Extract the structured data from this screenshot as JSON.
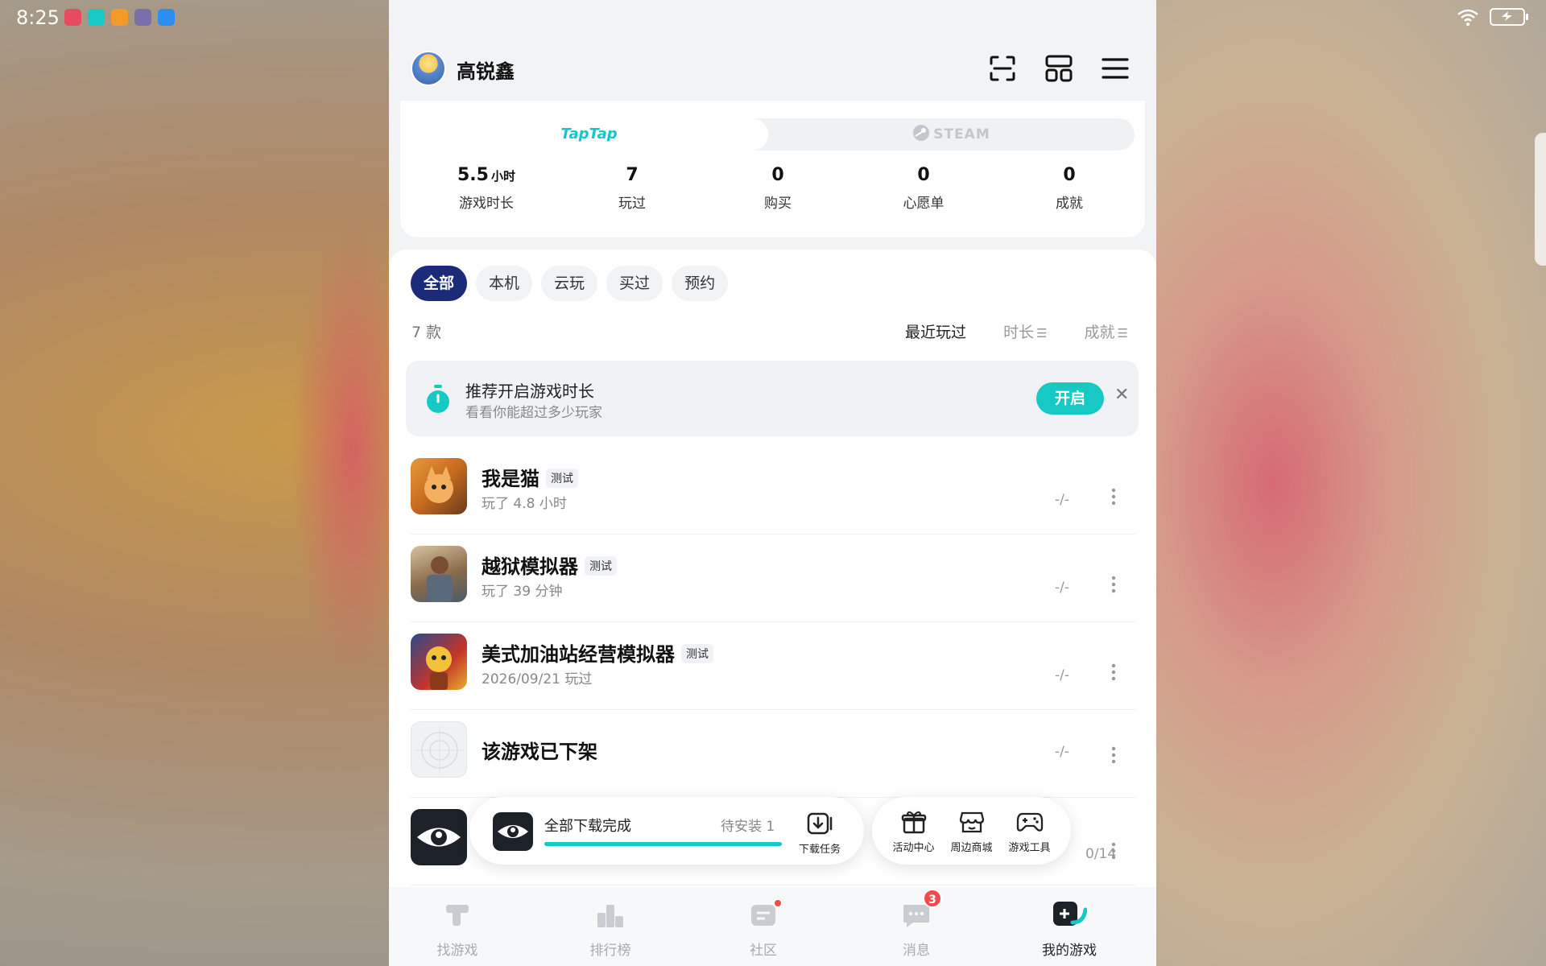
{
  "status_bar": {
    "time": "8:25",
    "app_icons": [
      "app-icon-red",
      "app-icon-taptap",
      "app-icon-orange",
      "app-icon-game",
      "app-icon-blue"
    ]
  },
  "header": {
    "username": "高锐鑫",
    "icons": [
      "scan-icon",
      "layout-icon",
      "menu-icon"
    ]
  },
  "platforms": {
    "taptap": "TapTap",
    "steam": "STEAM"
  },
  "stats": [
    {
      "value": "5.5",
      "unit": "小时",
      "label": "游戏时长"
    },
    {
      "value": "7",
      "unit": "",
      "label": "玩过"
    },
    {
      "value": "0",
      "unit": "",
      "label": "购买"
    },
    {
      "value": "0",
      "unit": "",
      "label": "心愿单"
    },
    {
      "value": "0",
      "unit": "",
      "label": "成就"
    }
  ],
  "filters": [
    "全部",
    "本机",
    "云玩",
    "买过",
    "预约"
  ],
  "active_filter": "全部",
  "count_text": "7 款",
  "sorts": {
    "recent": "最近玩过",
    "duration": "时长",
    "achievement": "成就"
  },
  "banner": {
    "title": "推荐开启游戏时长",
    "subtitle": "看看你能超过多少玩家",
    "button": "开启"
  },
  "games": [
    {
      "title": "我是猫",
      "badge": "测试",
      "sub": "玩了 4.8 小时",
      "ach": "-/-"
    },
    {
      "title": "越狱模拟器",
      "badge": "测试",
      "sub": "玩了 39 分钟",
      "ach": "-/-"
    },
    {
      "title": "美式加油站经营模拟器",
      "badge": "测试",
      "sub": "2026/09/21 玩过",
      "ach": "-/-"
    },
    {
      "title": "该游戏已下架",
      "badge": "",
      "sub": "",
      "ach": "-/-"
    },
    {
      "title": "",
      "badge": "",
      "sub": "",
      "ach": "0/14"
    }
  ],
  "download": {
    "title": "全部下载完成",
    "pending": "待安装 1",
    "task_label": "下载任务",
    "progress": 1.0
  },
  "tools": [
    "活动中心",
    "周边商城",
    "游戏工具"
  ],
  "nav": [
    {
      "label": "找游戏",
      "icon": "find-game-icon"
    },
    {
      "label": "排行榜",
      "icon": "ranking-icon"
    },
    {
      "label": "社区",
      "icon": "community-icon"
    },
    {
      "label": "消息",
      "icon": "message-icon",
      "badge": "3"
    },
    {
      "label": "我的游戏",
      "icon": "my-games-icon"
    }
  ],
  "colors": {
    "accent": "#16c9c5",
    "active_chip": "#1c2a7a",
    "badge": "#f24b4b"
  }
}
